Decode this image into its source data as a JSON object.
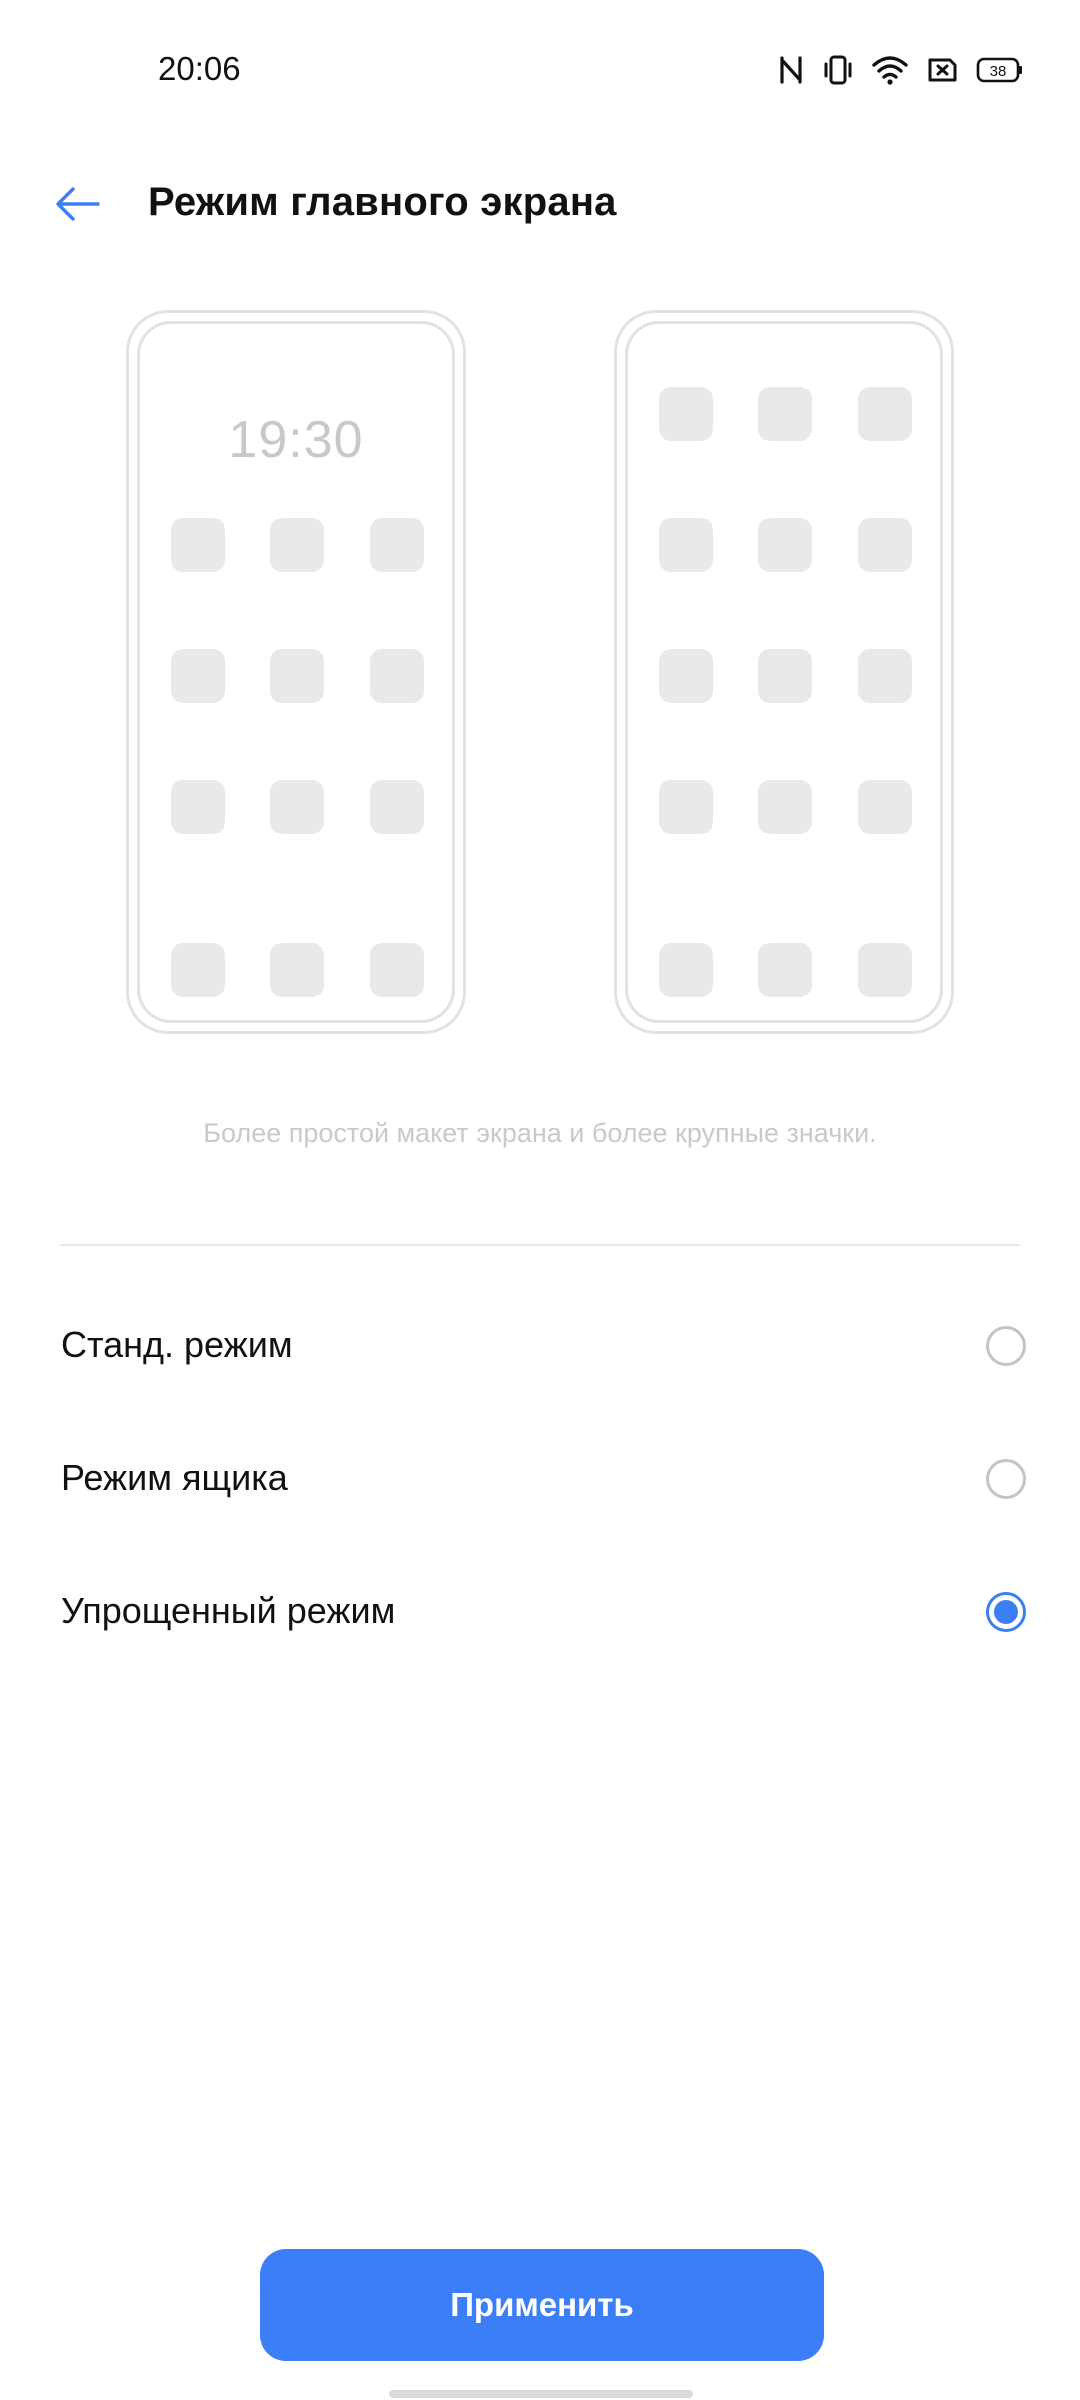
{
  "status_bar": {
    "time": "20:06",
    "battery_level": "38",
    "icons": [
      "nfc-icon",
      "vibrate-icon",
      "wifi-icon",
      "sim-off-icon",
      "battery-icon"
    ]
  },
  "header": {
    "back_icon": "arrow-left-icon",
    "title": "Режим главного экрана"
  },
  "preview": {
    "clock": "19:30",
    "description": "Более простой макет экрана и более крупные значки."
  },
  "options": [
    {
      "label": "Станд. режим",
      "selected": false
    },
    {
      "label": "Режим ящика",
      "selected": false
    },
    {
      "label": "Упрощенный режим",
      "selected": true
    }
  ],
  "apply_label": "Применить",
  "colors": {
    "accent": "#3b7ef8",
    "tile": "#e9e9e9",
    "hint_text": "#c9c9c9"
  }
}
